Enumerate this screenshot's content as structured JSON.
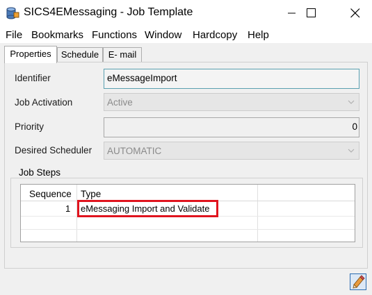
{
  "window": {
    "title": "SICS4EMessaging - Job Template"
  },
  "menu": {
    "items": [
      "File",
      "Bookmarks",
      "Functions",
      "Window",
      "Hardcopy",
      "Help"
    ]
  },
  "tabs": [
    "Properties",
    "Schedule",
    "E- mail"
  ],
  "form": {
    "identifier": {
      "label": "Identifier",
      "value": "eMessageImport"
    },
    "job_activation": {
      "label": "Job Activation",
      "value": "Active"
    },
    "priority": {
      "label": "Priority",
      "value": "0"
    },
    "desired_scheduler": {
      "label": "Desired Scheduler",
      "value": "AUTOMATIC"
    }
  },
  "job_steps": {
    "title": "Job Steps",
    "columns": [
      "Sequence",
      "Type"
    ],
    "rows": [
      {
        "sequence": "1",
        "type": "eMessaging Import and Validate"
      }
    ]
  },
  "colors": {
    "highlight": "#e0141e",
    "focus_border": "#5aa0b0"
  },
  "icons": [
    "app-database-icon",
    "minimize-icon",
    "maximize-icon",
    "close-icon",
    "chevron-down-icon",
    "edit-pencil-icon"
  ]
}
